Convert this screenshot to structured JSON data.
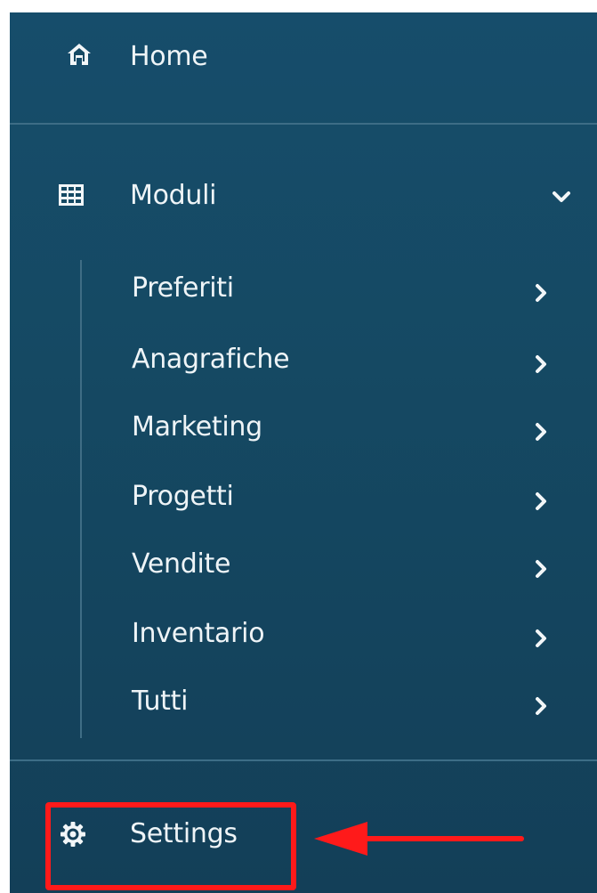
{
  "nav": {
    "home": {
      "label": "Home",
      "icon": "home-icon"
    },
    "moduli": {
      "label": "Moduli",
      "icon": "grid-icon",
      "expanded": true
    },
    "submenu": [
      {
        "label": "Preferiti"
      },
      {
        "label": "Anagrafiche"
      },
      {
        "label": "Marketing"
      },
      {
        "label": "Progetti"
      },
      {
        "label": "Vendite"
      },
      {
        "label": "Inventario"
      },
      {
        "label": "Tutti"
      }
    ],
    "settings": {
      "label": "Settings",
      "icon": "gear-icon"
    }
  },
  "annotation": {
    "highlight_color": "#ff1a1a",
    "target": "Settings"
  },
  "colors": {
    "sidebar_bg": "#154963",
    "text": "#eef4f7",
    "divider": "#3d6d86"
  }
}
